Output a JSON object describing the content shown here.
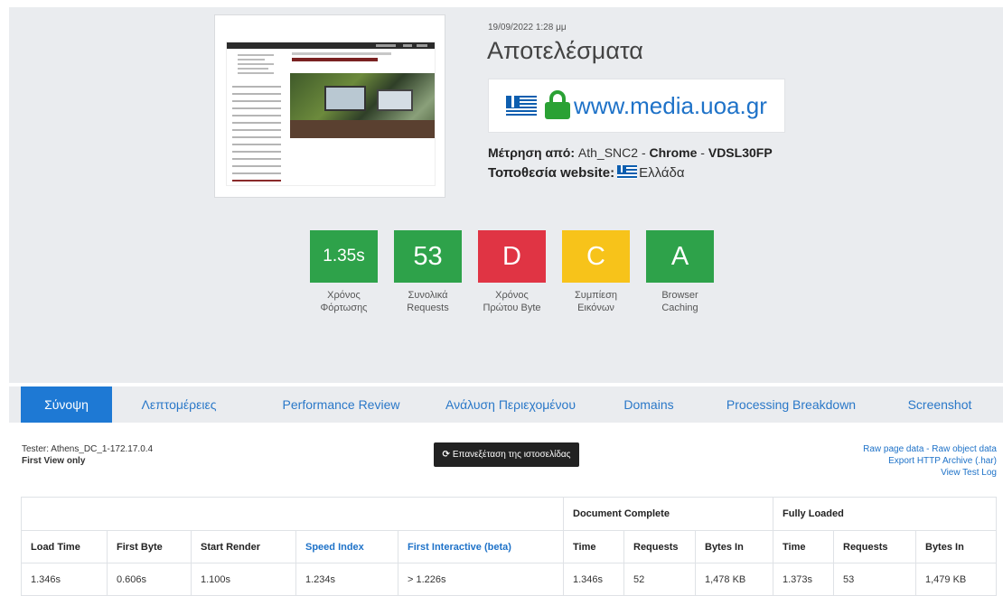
{
  "header": {
    "date": "19/09/2022 1:28 μμ",
    "title": "Αποτελέσματα",
    "url": "www.media.uoa.gr",
    "measurement_label": "Μέτρηση από:",
    "measurement_location": "Ath_SNC2",
    "measurement_sep1": "-",
    "browser": "Chrome",
    "measurement_sep2": "-",
    "connection": "VDSL30FP",
    "website_location_label": "Τοποθεσία website:",
    "website_location": "Ελλάδα"
  },
  "scores": [
    {
      "value": "1.35s",
      "label1": "Χρόνος",
      "label2": "Φόρτωσης",
      "color": "#2ea24a"
    },
    {
      "value": "53",
      "label1": "Συνολικά",
      "label2": "Requests",
      "color": "#2ea24a"
    },
    {
      "value": "D",
      "label1": "Χρόνος",
      "label2": "Πρώτου Byte",
      "color": "#e03444"
    },
    {
      "value": "C",
      "label1": "Συμπίεση",
      "label2": "Εικόνων",
      "color": "#f7c31a"
    },
    {
      "value": "A",
      "label1": "Browser",
      "label2": "Caching",
      "color": "#2ea24a"
    }
  ],
  "tabs": [
    {
      "label": "Σύνοψη"
    },
    {
      "label": "Λεπτομέρειες"
    },
    {
      "label": "Performance Review"
    },
    {
      "label": "Ανάλυση Περιεχομένου"
    },
    {
      "label": "Domains"
    },
    {
      "label": "Processing Breakdown"
    },
    {
      "label": "Screenshot"
    }
  ],
  "info": {
    "tester": "Tester: Athens_DC_1-172.17.0.4",
    "view": "First View only",
    "retest_label": "Επανεξέταση της ιστοσελίδας",
    "raw_page": "Raw page data",
    "link_sep": " - ",
    "raw_object": "Raw object data",
    "export_har": "Export HTTP Archive (.har)",
    "view_log": "View Test Log"
  },
  "table": {
    "group_doc": "Document Complete",
    "group_full": "Fully Loaded",
    "headers": [
      "Load Time",
      "First Byte",
      "Start Render",
      "Speed Index",
      "First Interactive (beta)",
      "Time",
      "Requests",
      "Bytes In",
      "Time",
      "Requests",
      "Bytes In"
    ],
    "row": [
      "1.346s",
      "0.606s",
      "1.100s",
      "1.234s",
      "> 1.226s",
      "1.346s",
      "52",
      "1,478 KB",
      "1.373s",
      "53",
      "1,479 KB"
    ]
  }
}
